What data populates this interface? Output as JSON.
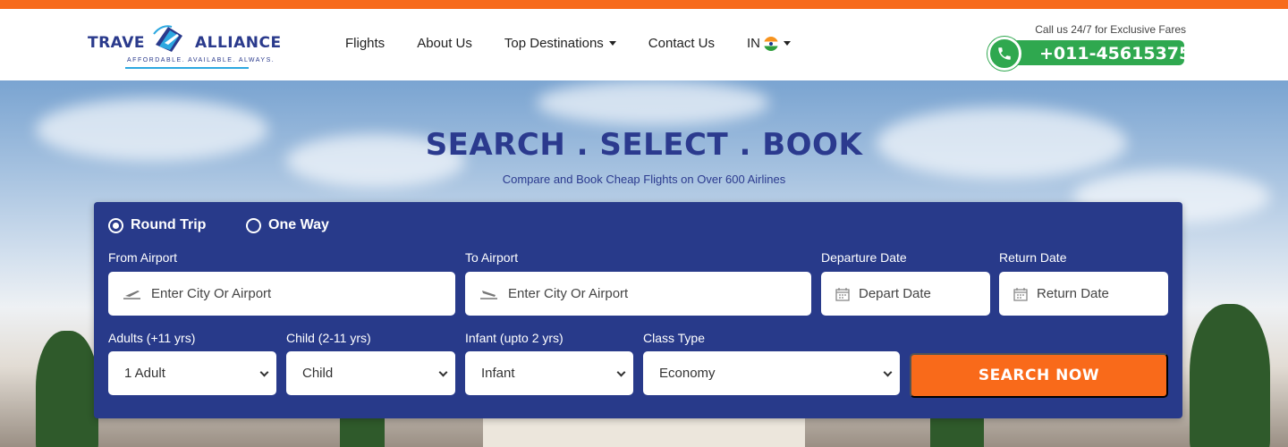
{
  "brand": {
    "name_left": "TRAVE",
    "name_right": "ALLIANCE",
    "tagline": "AFFORDABLE. AVAILABLE. ALWAYS."
  },
  "nav": {
    "items": [
      {
        "label": "Flights"
      },
      {
        "label": "About Us"
      },
      {
        "label": "Top Destinations"
      },
      {
        "label": "Contact Us"
      },
      {
        "label": "IN"
      }
    ]
  },
  "contact": {
    "caption": "Call us 24/7 for Exclusive Fares",
    "phone": "+011-45615375"
  },
  "hero": {
    "title": "SEARCH . SELECT . BOOK",
    "subtitle": "Compare and Book Cheap Flights on Over 600 Airlines"
  },
  "search": {
    "trip_types": [
      {
        "label": "Round Trip",
        "selected": true
      },
      {
        "label": "One Way",
        "selected": false
      }
    ],
    "from": {
      "label": "From Airport",
      "placeholder": "Enter City Or Airport"
    },
    "to": {
      "label": "To Airport",
      "placeholder": "Enter City Or Airport"
    },
    "depart": {
      "label": "Departure Date",
      "placeholder": "Depart Date"
    },
    "return": {
      "label": "Return Date",
      "placeholder": "Return Date"
    },
    "adults": {
      "label": "Adults (+11 yrs)",
      "value": "1 Adult"
    },
    "child": {
      "label": "Child (2-11 yrs)",
      "value": "Child"
    },
    "infant": {
      "label": "Infant (upto 2 yrs)",
      "value": "Infant"
    },
    "class": {
      "label": "Class Type",
      "value": "Economy"
    },
    "submit_label": "SEARCH NOW"
  },
  "colors": {
    "accent": "#f96a1a",
    "panel": "#283a8a",
    "phone_green": "#2fa84f",
    "title_blue": "#2b3a8e"
  },
  "icons": [
    "takeoff-icon",
    "landing-icon",
    "calendar-icon",
    "phone-icon",
    "india-flag-icon",
    "chevron-down-icon"
  ]
}
